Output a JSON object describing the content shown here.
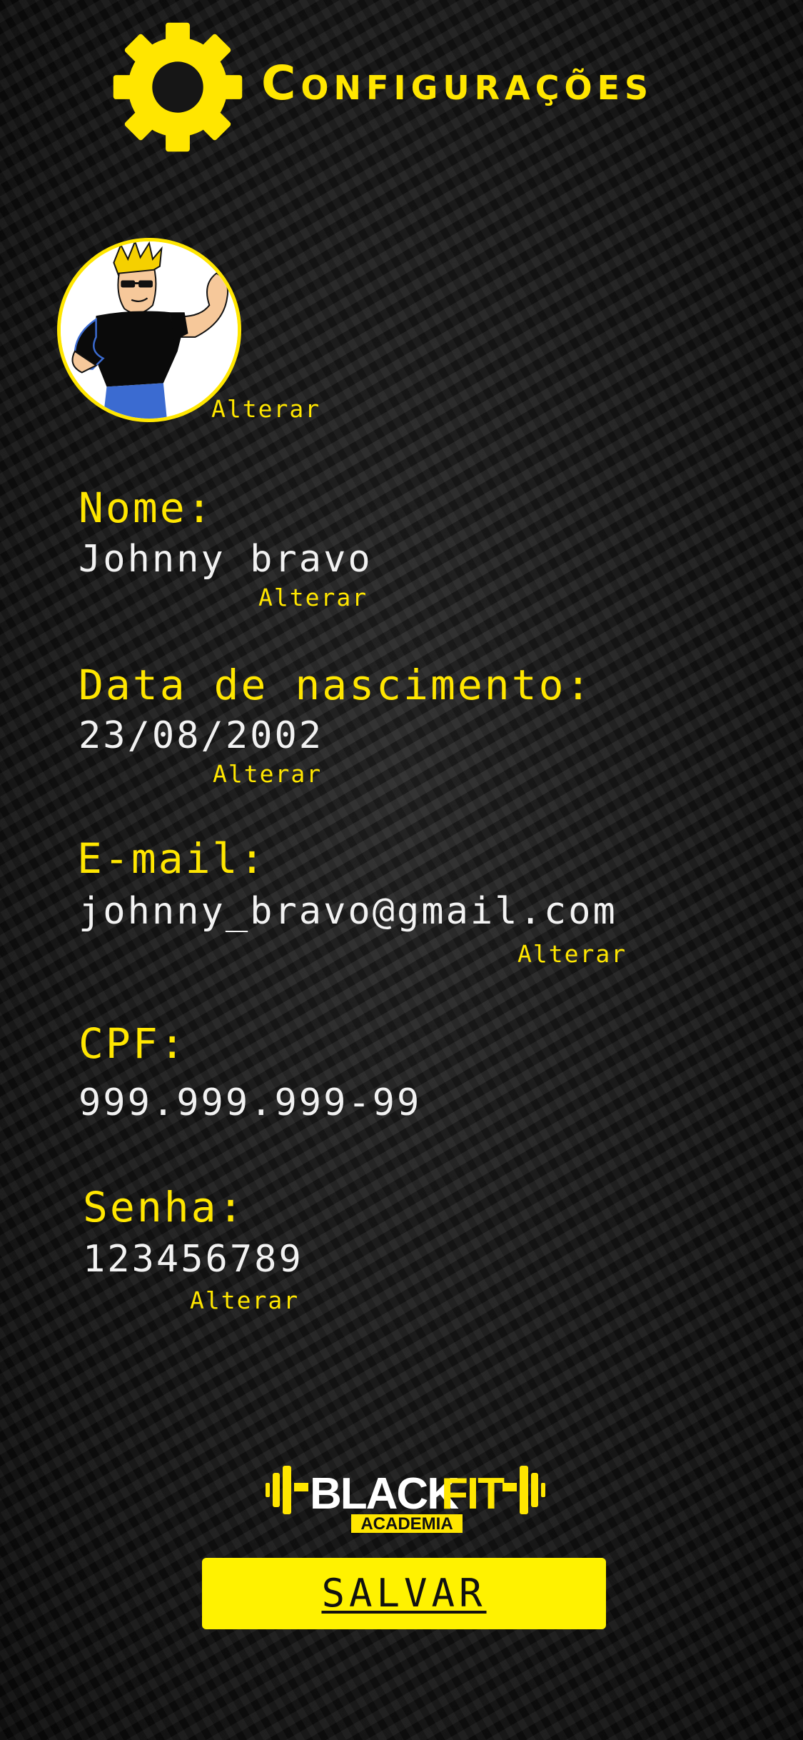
{
  "header": {
    "title": "Configurações",
    "icon": "gear-icon"
  },
  "profile": {
    "avatar_icon": "avatar-johnny-bravo",
    "change_photo_label": "Alterar"
  },
  "fields": {
    "name": {
      "label": "Nome:",
      "value": "Johnny bravo",
      "action": "Alterar"
    },
    "birthdate": {
      "label": "Data de nascimento:",
      "value": "23/08/2002",
      "action": "Alterar"
    },
    "email": {
      "label": "E-mail:",
      "value": "johnny_bravo@gmail.com",
      "action": "Alterar"
    },
    "cpf": {
      "label": "CPF:",
      "value": "999.999.999-99"
    },
    "password": {
      "label": "Senha:",
      "value": "123456789",
      "action": "Alterar"
    }
  },
  "brand": {
    "name_black": "BLACK",
    "name_fit": "FIT",
    "subtitle": "ACADEMIA"
  },
  "footer": {
    "save_label": "SALVAR"
  },
  "colors": {
    "accent": "#ffe600",
    "button": "#fff200",
    "background": "#121212",
    "value_text": "#f2f2f2"
  }
}
